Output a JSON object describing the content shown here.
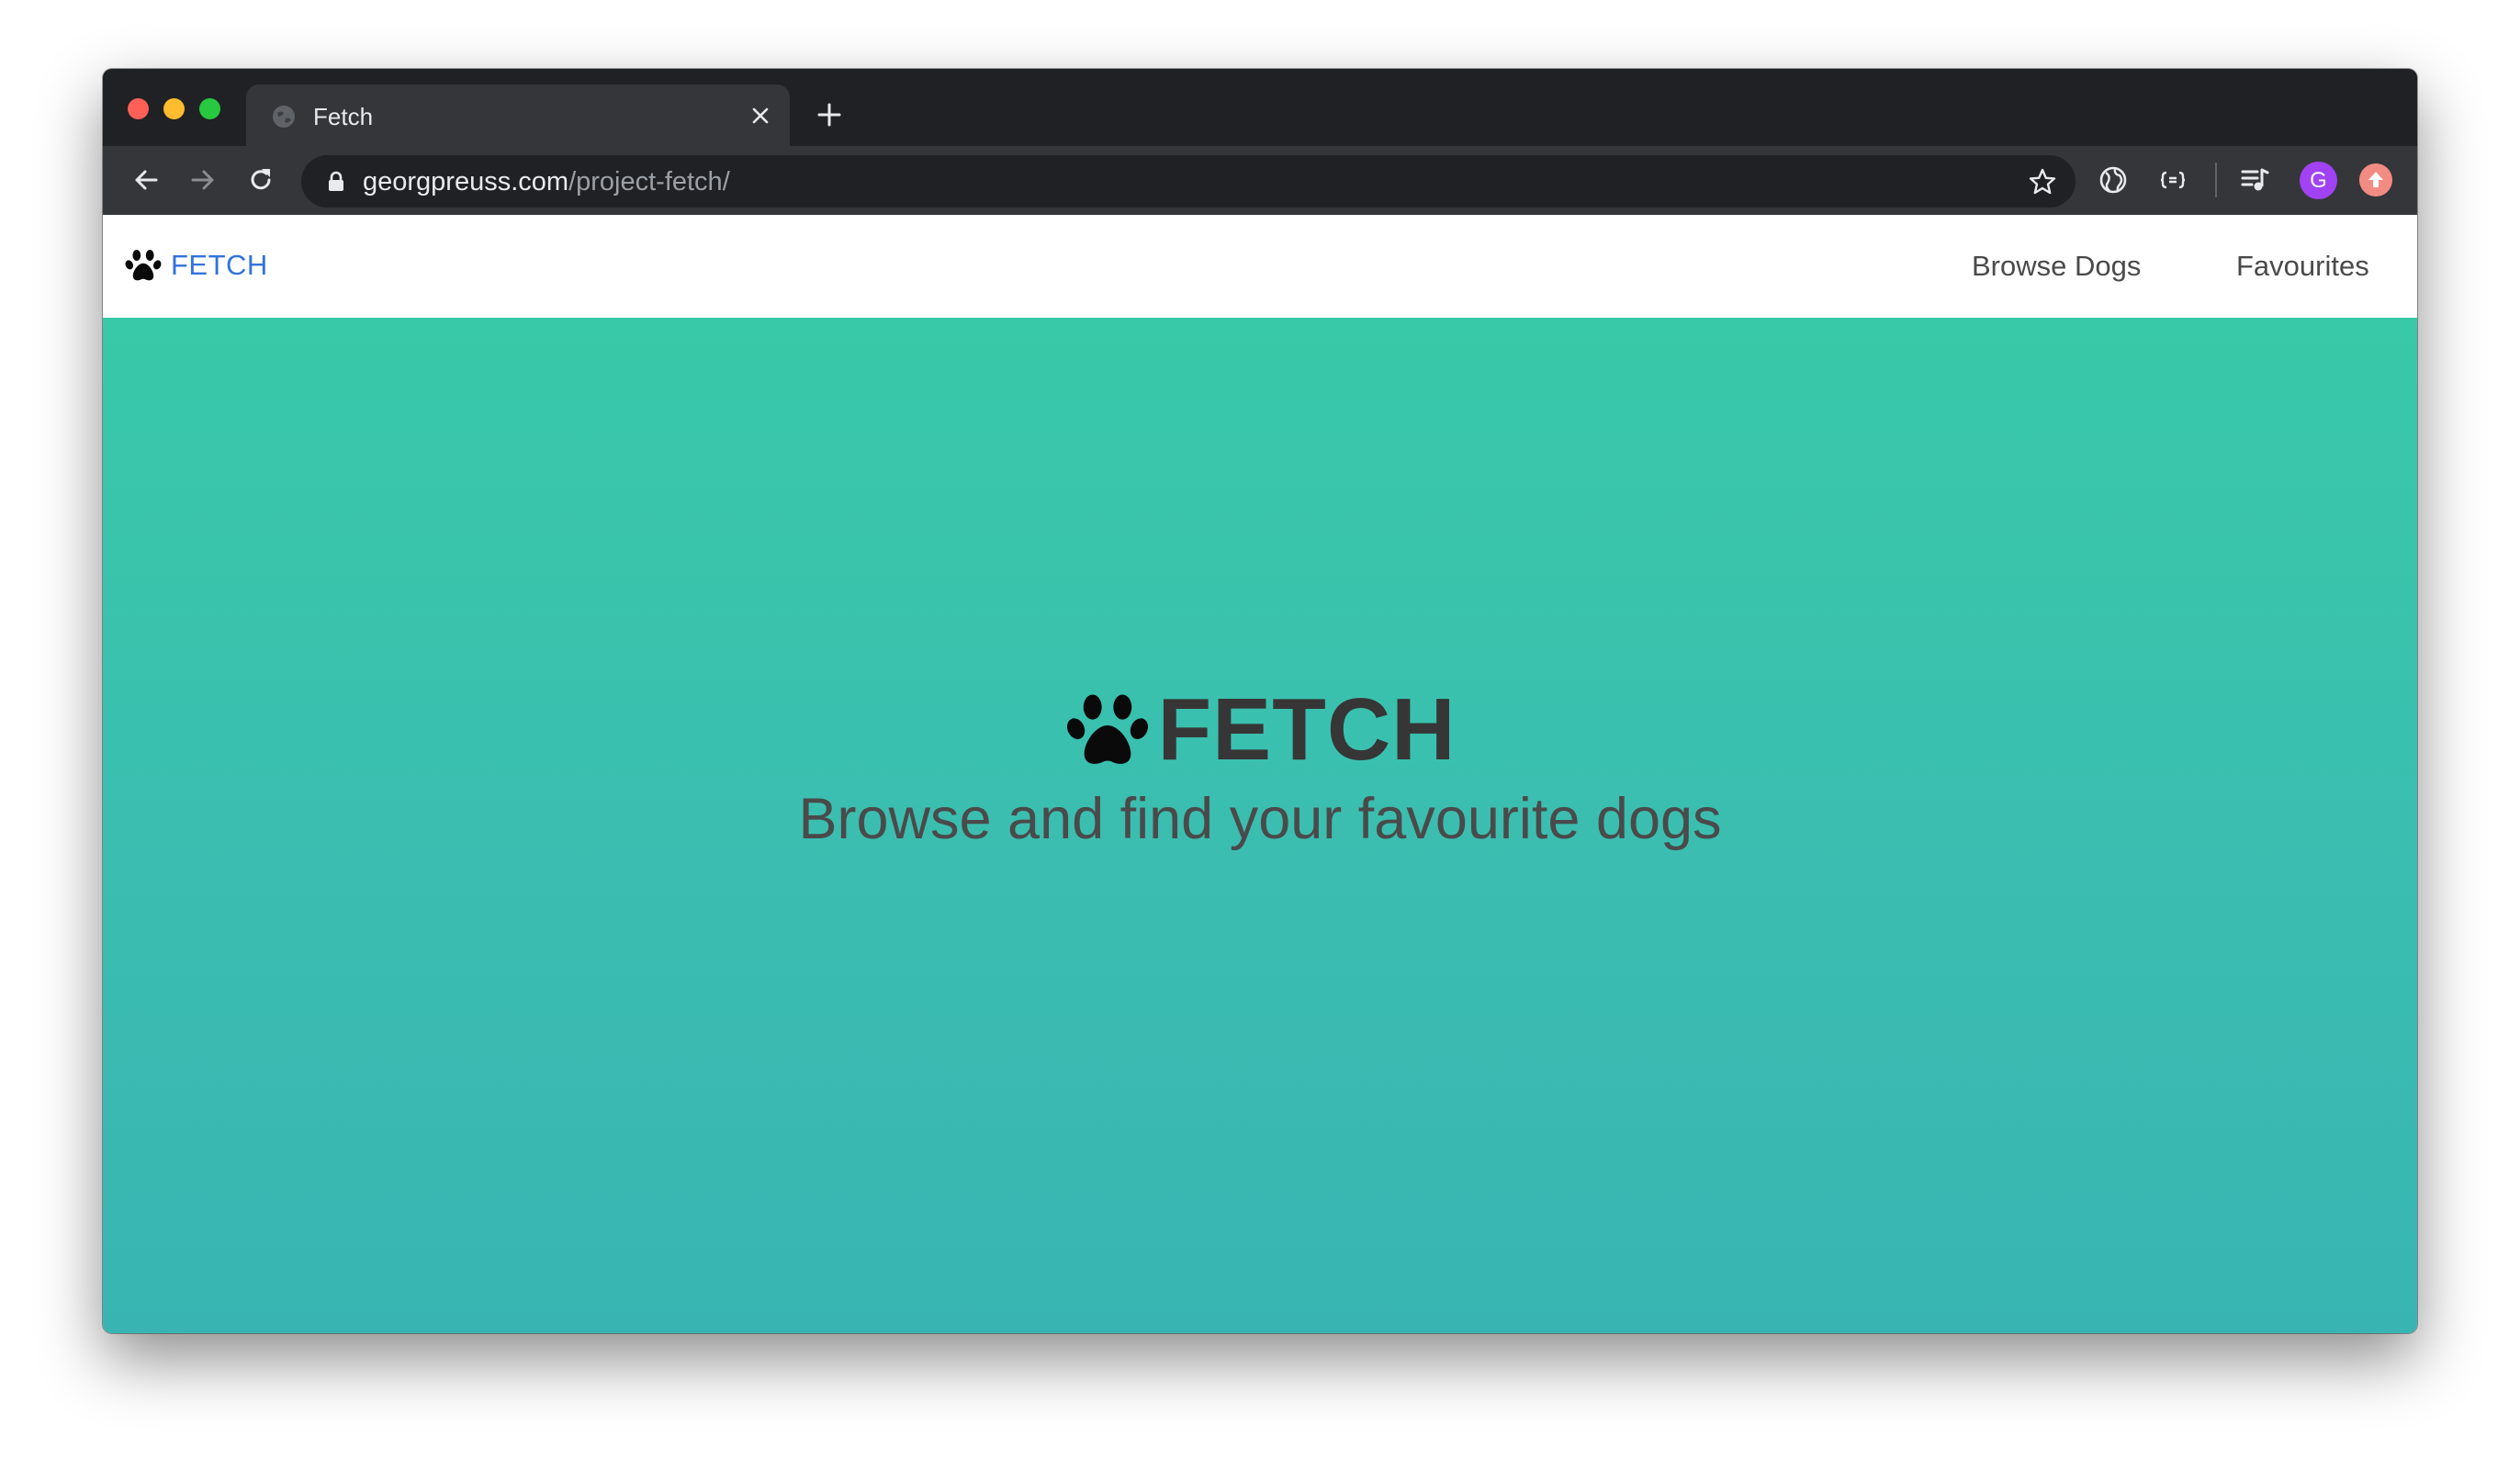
{
  "browser": {
    "tab": {
      "title": "Fetch"
    },
    "address_bar": {
      "domain": "georgpreuss.com",
      "path": "/project-fetch/"
    },
    "profile_initial": "G"
  },
  "site": {
    "brand": {
      "label": "FETCH",
      "icon": "paw-icon",
      "color": "#3273dc"
    },
    "nav": {
      "links": [
        {
          "label": "Browse Dogs"
        },
        {
          "label": "Favourites"
        }
      ]
    },
    "hero": {
      "title": "FETCH",
      "subtitle": "Browse and find your favourite dogs",
      "icon": "paw-icon",
      "gradient_top": "#38c9a8",
      "gradient_bottom": "#38b5b2"
    }
  }
}
